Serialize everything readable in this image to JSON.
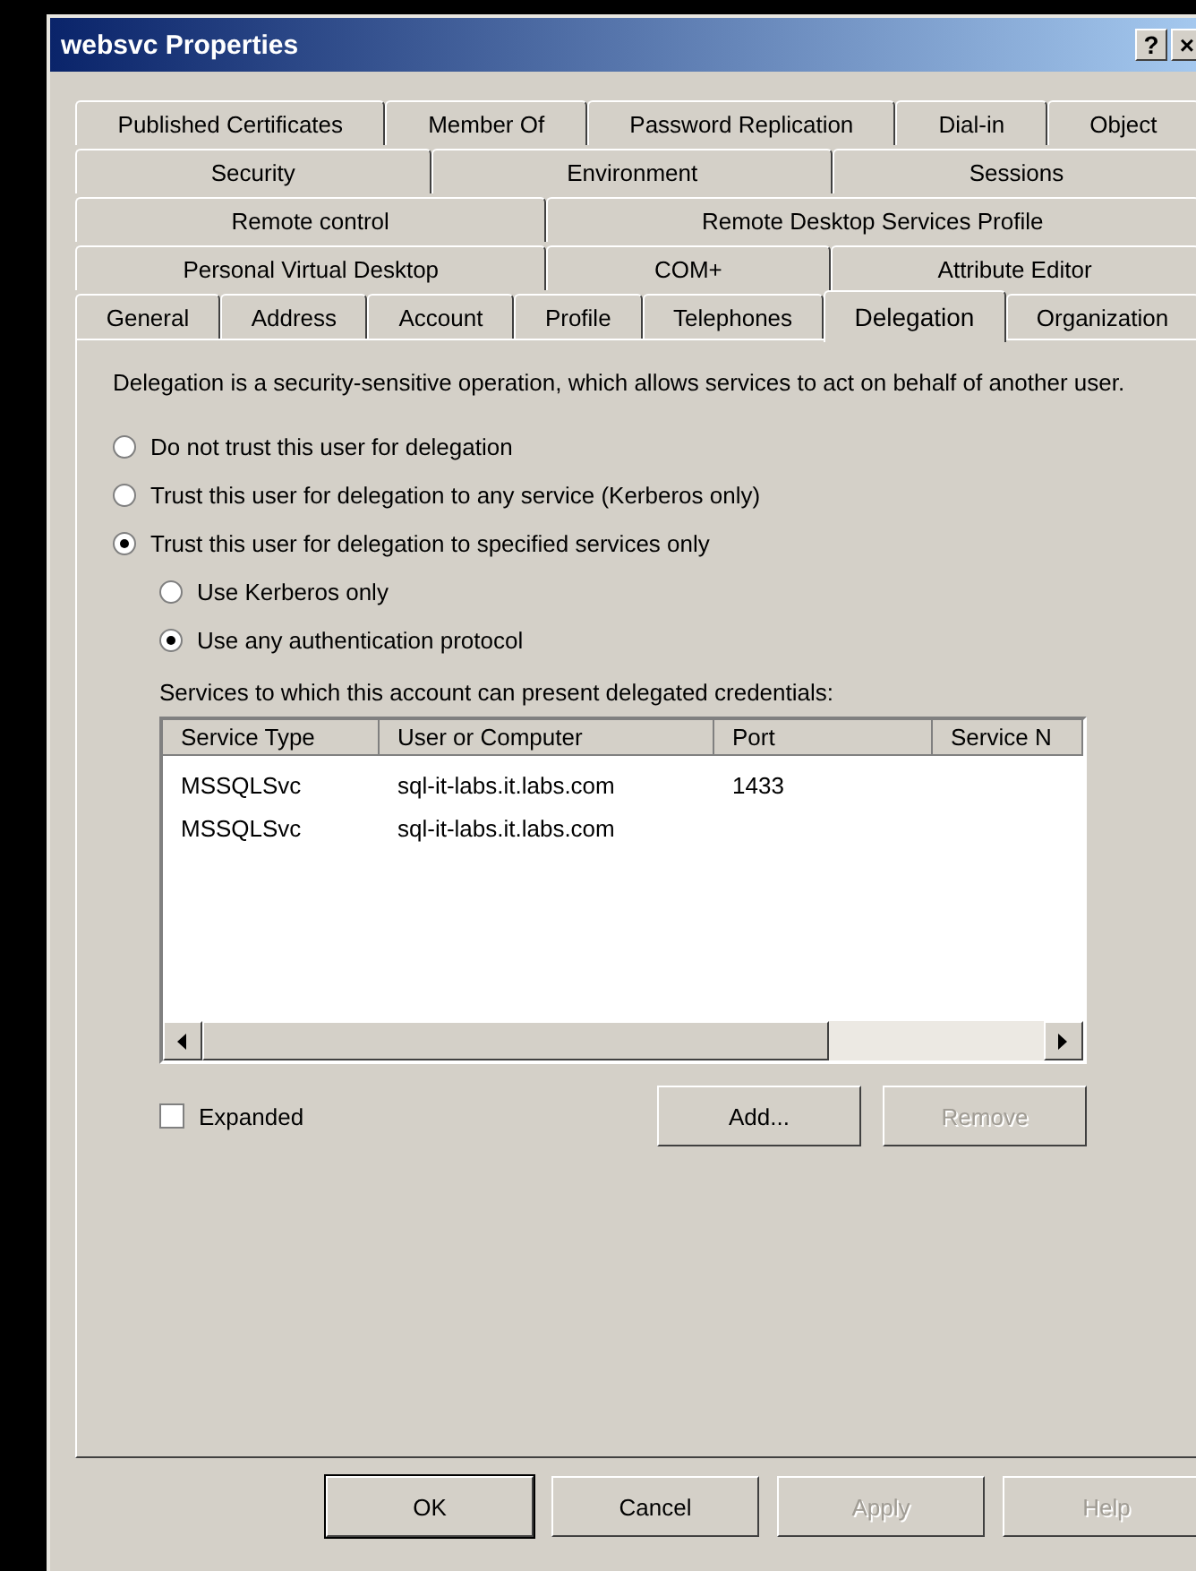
{
  "window": {
    "title": "websvc Properties",
    "buttons": [
      "?",
      "×"
    ]
  },
  "tab_rows": [
    {
      "tabs": [
        {
          "label": "Published Certificates",
          "selected": false
        },
        {
          "label": "Member Of",
          "selected": false
        },
        {
          "label": "Password Replication",
          "selected": false
        },
        {
          "label": "Dial-in",
          "selected": false
        },
        {
          "label": "Object",
          "selected": false
        }
      ]
    },
    {
      "tabs": [
        {
          "label": "Security",
          "selected": false
        },
        {
          "label": "Environment",
          "selected": false
        },
        {
          "label": "Sessions",
          "selected": false
        }
      ]
    },
    {
      "tabs": [
        {
          "label": "Remote control",
          "selected": false
        },
        {
          "label": "Remote Desktop Services Profile",
          "selected": false
        }
      ]
    },
    {
      "tabs": [
        {
          "label": "Personal Virtual Desktop",
          "selected": false
        },
        {
          "label": "COM+",
          "selected": false
        },
        {
          "label": "Attribute Editor",
          "selected": false
        }
      ]
    },
    {
      "tabs": [
        {
          "label": "General",
          "selected": false
        },
        {
          "label": "Address",
          "selected": false
        },
        {
          "label": "Account",
          "selected": false
        },
        {
          "label": "Profile",
          "selected": false
        },
        {
          "label": "Telephones",
          "selected": false
        },
        {
          "label": "Delegation",
          "selected": true
        },
        {
          "label": "Organization",
          "selected": false
        }
      ]
    }
  ],
  "description": "Delegation is a security-sensitive operation, which allows services to act on behalf of another user.",
  "trust_options": [
    {
      "label": "Do not trust this user for delegation",
      "selected": false
    },
    {
      "label": "Trust this user for delegation to any service (Kerberos only)",
      "selected": false
    },
    {
      "label": "Trust this user for delegation to specified services only",
      "selected": true
    }
  ],
  "protocol_options": [
    {
      "label": "Use Kerberos only",
      "selected": false
    },
    {
      "label": "Use any authentication protocol",
      "selected": true
    }
  ],
  "services": {
    "label": "Services to which this account can present delegated credentials:",
    "columns": [
      "Service Type",
      "User or Computer",
      "Port",
      "Service N"
    ],
    "rows": [
      [
        "MSSQLSvc",
        "sql-it-labs.it.labs.com",
        "1433"
      ],
      [
        "MSSQLSvc",
        "sql-it-labs.it.labs.com",
        ""
      ]
    ]
  },
  "expanded": {
    "label": "Expanded",
    "checked": false
  },
  "list_buttons": [
    {
      "label": "Add...",
      "disabled": false
    },
    {
      "label": "Remove",
      "disabled": true
    }
  ],
  "buttons": [
    {
      "label": "OK",
      "disabled": false,
      "default": true
    },
    {
      "label": "Cancel",
      "disabled": false,
      "default": false
    },
    {
      "label": "Apply",
      "disabled": true,
      "default": false
    },
    {
      "label": "Help",
      "disabled": true,
      "default": false
    }
  ]
}
